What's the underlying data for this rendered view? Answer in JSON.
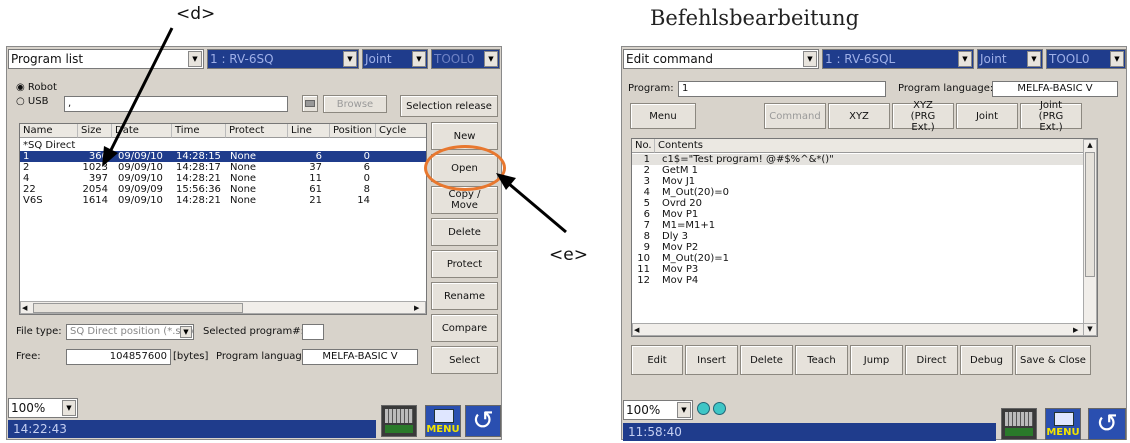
{
  "annotations": {
    "d": "<d>",
    "e": "<e>",
    "right_title": "Befehlsbearbeitung"
  },
  "left": {
    "dropdown_screen": "Program list",
    "dropdown_robot": "1 : RV-6SQ",
    "dropdown_joint": "Joint",
    "dropdown_tool": "TOOL0",
    "radio_robot": "Robot",
    "radio_usb": "USB",
    "usb_path": ",",
    "browse_label": "Browse",
    "selection_release_label": "Selection release",
    "columns": [
      "Name",
      "Size",
      "Date",
      "Time",
      "Protect",
      "Line",
      "Position",
      "Cycle"
    ],
    "rows": [
      [
        "*SQ Direct",
        "",
        "",
        "",
        "",
        "",
        "",
        ""
      ],
      [
        "1",
        "360",
        "09/09/10",
        "14:28:15",
        "None",
        "6",
        "0",
        ""
      ],
      [
        "2",
        "1023",
        "09/09/10",
        "14:28:17",
        "None",
        "37",
        "6",
        ""
      ],
      [
        "4",
        "397",
        "09/09/10",
        "14:28:21",
        "None",
        "11",
        "0",
        ""
      ],
      [
        "22",
        "2054",
        "09/09/09",
        "15:56:36",
        "None",
        "61",
        "8",
        ""
      ],
      [
        "V6S",
        "1614",
        "09/09/10",
        "14:28:21",
        "None",
        "21",
        "14",
        ""
      ]
    ],
    "buttons": [
      "New",
      "Open",
      "Copy / Move",
      "Delete",
      "Protect",
      "Rename",
      "Compare",
      "Select"
    ],
    "file_type_label": "File type:",
    "file_type_value": "SQ Direct position (*.sdp",
    "selected_program_label": "Selected program#:",
    "free_label": "Free:",
    "free_value": "104857600",
    "free_unit": "[bytes]",
    "program_language_label": "Program language:",
    "program_language_value": "MELFA-BASIC V",
    "zoom": "100%",
    "time": "14:22:43",
    "menu_icon_text": "MENU"
  },
  "right": {
    "dropdown_screen": "Edit command",
    "dropdown_robot": "1 : RV-6SQL",
    "dropdown_joint": "Joint",
    "dropdown_tool": "TOOL0",
    "program_label": "Program:",
    "program_value": "1",
    "program_language_label": "Program language:",
    "program_language_value": "MELFA-BASIC V",
    "menu_label": "Menu",
    "command_label": "Command",
    "xyz_label": "XYZ",
    "xyz_ext_label": "XYZ (PRG Ext.)",
    "joint_label": "Joint",
    "joint_ext_label": "Joint (PRG Ext.)",
    "col_no": "No.",
    "col_contents": "Contents",
    "lines": [
      [
        "1",
        "c1$=\"Test program! @#$%^&*()\""
      ],
      [
        "2",
        "GetM 1"
      ],
      [
        "3",
        "Mov J1"
      ],
      [
        "4",
        "M_Out(20)=0"
      ],
      [
        "5",
        "Ovrd 20"
      ],
      [
        "6",
        "Mov P1"
      ],
      [
        "7",
        "M1=M1+1"
      ],
      [
        "8",
        "Dly 3"
      ],
      [
        "9",
        "Mov P2"
      ],
      [
        "10",
        "M_Out(20)=1"
      ],
      [
        "11",
        "Mov P3"
      ],
      [
        "12",
        "Mov P4"
      ]
    ],
    "bottom_buttons": [
      "Edit",
      "Insert",
      "Delete",
      "Teach",
      "Jump",
      "Direct",
      "Debug",
      "Save & Close"
    ],
    "zoom": "100%",
    "time": "11:58:40",
    "menu_icon_text": "MENU"
  },
  "colors": {
    "highlight": "#1f3c8c",
    "callout_circle": "#e8772e",
    "panel": "#d8d3cb"
  }
}
